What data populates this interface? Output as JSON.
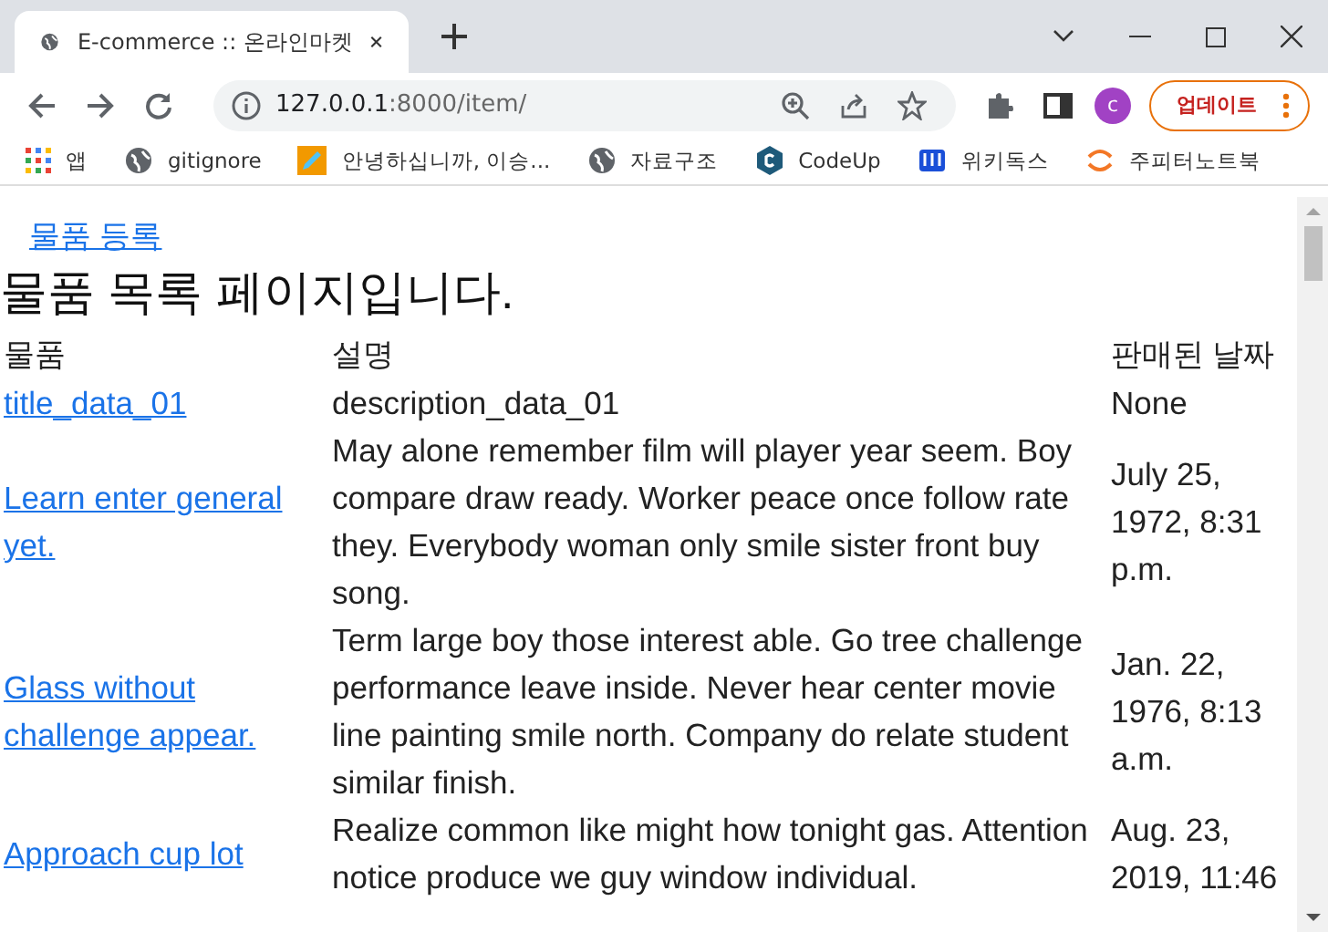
{
  "tabs": [
    {
      "title": "E-commerce :: 온라인마켓",
      "selected": true
    }
  ],
  "address_bar": {
    "host": "127.0.0.1",
    "path": ":8000/item/"
  },
  "profile": {
    "initial": "c"
  },
  "update_button": {
    "label": "업데이트"
  },
  "bookmarks": [
    {
      "label": "앱",
      "kind": "apps"
    },
    {
      "label": "gitignore",
      "kind": "globe"
    },
    {
      "label": "안녕하십니까, 이승...",
      "kind": "pencil"
    },
    {
      "label": "자료구조",
      "kind": "globe"
    },
    {
      "label": "CodeUp",
      "kind": "codeup"
    },
    {
      "label": "위키독스",
      "kind": "wiki"
    },
    {
      "label": "주피터노트북",
      "kind": "jupyter"
    }
  ],
  "page": {
    "register_link": "물품 등록",
    "heading": "물품 목록 페이지입니다.",
    "table": {
      "columns": [
        "물품",
        "설명",
        "판매된 날짜"
      ],
      "rows": [
        {
          "title": "title_data_01",
          "description": "description_data_01",
          "sold_date": "None"
        },
        {
          "title": "Learn enter general yet.",
          "description": "May alone remember film will player year seem. Boy compare draw ready. Worker peace once follow rate they. Everybody woman only smile sister front buy song.",
          "sold_date": "July 25, 1972, 8:31 p.m."
        },
        {
          "title": "Glass without challenge appear.",
          "description": "Term large boy those interest able. Go tree challenge performance leave inside. Never hear center movie line painting smile north. Company do relate student similar finish.",
          "sold_date": "Jan. 22, 1976, 8:13 a.m."
        },
        {
          "title": "Approach cup lot",
          "description": "Realize common like might how tonight gas. Attention notice produce we guy window individual.",
          "sold_date": "Aug. 23, 2019, 11:46"
        }
      ]
    }
  }
}
